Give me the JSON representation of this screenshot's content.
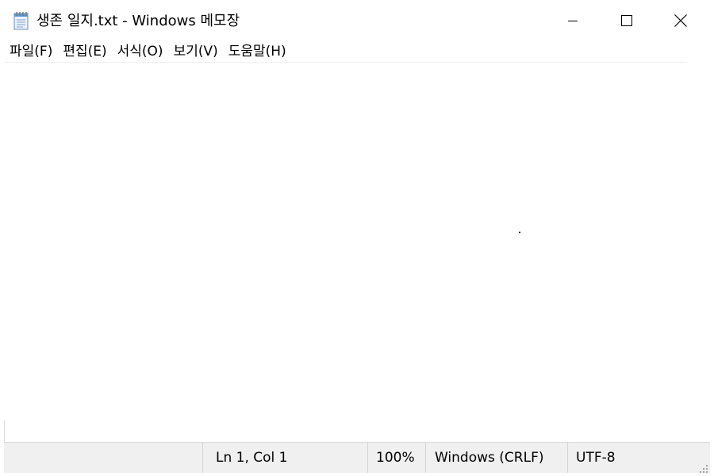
{
  "window": {
    "title": "생존 일지.txt - Windows 메모장"
  },
  "icons": {
    "app": "notepad-icon",
    "minimize": "minimize-icon",
    "maximize": "maximize-icon",
    "close": "close-icon",
    "grip": "resize-grip-icon"
  },
  "menu": {
    "items": [
      {
        "label": "파일(F)"
      },
      {
        "label": "편집(E)"
      },
      {
        "label": "서식(O)"
      },
      {
        "label": "보기(V)"
      },
      {
        "label": "도움말(H)"
      }
    ]
  },
  "editor": {
    "content": ""
  },
  "status": {
    "position": "Ln 1, Col 1",
    "zoom": "100%",
    "line_ending": "Windows (CRLF)",
    "encoding": "UTF-8"
  },
  "colors": {
    "status_bg": "#f0f0f0",
    "window_bg": "#ffffff",
    "separator": "#d4d4d4"
  }
}
